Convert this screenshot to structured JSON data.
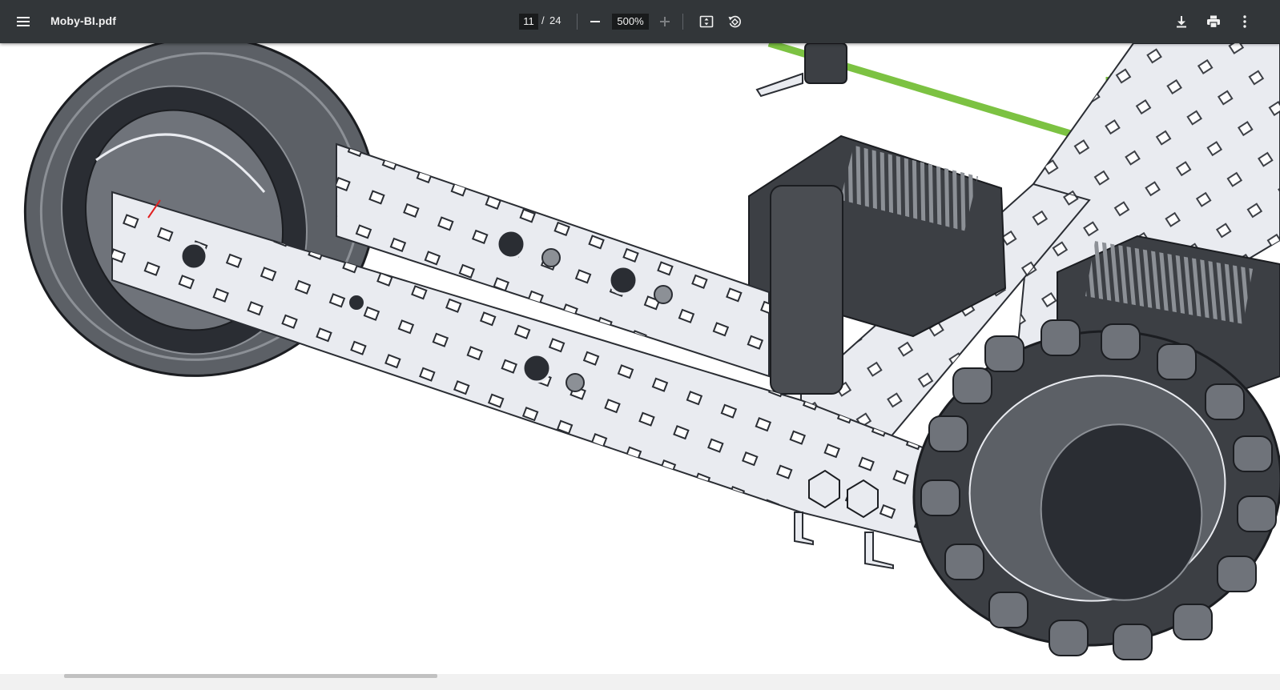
{
  "toolbar": {
    "file_name": "Moby-BI.pdf",
    "current_page": "11",
    "page_separator": "/",
    "total_pages": "24",
    "zoom": "500%"
  },
  "icons": {
    "menu": "menu-icon",
    "zoom_out": "minus-icon",
    "zoom_in": "plus-icon",
    "fit": "fit-to-page-icon",
    "rotate": "rotate-icon",
    "download": "download-icon",
    "print": "print-icon",
    "more": "more-vert-icon"
  },
  "colors": {
    "toolbar_bg": "#323639",
    "accent_green": "#7cc242",
    "metal": "#e9ebf0",
    "rubber": "#3c3f44"
  }
}
